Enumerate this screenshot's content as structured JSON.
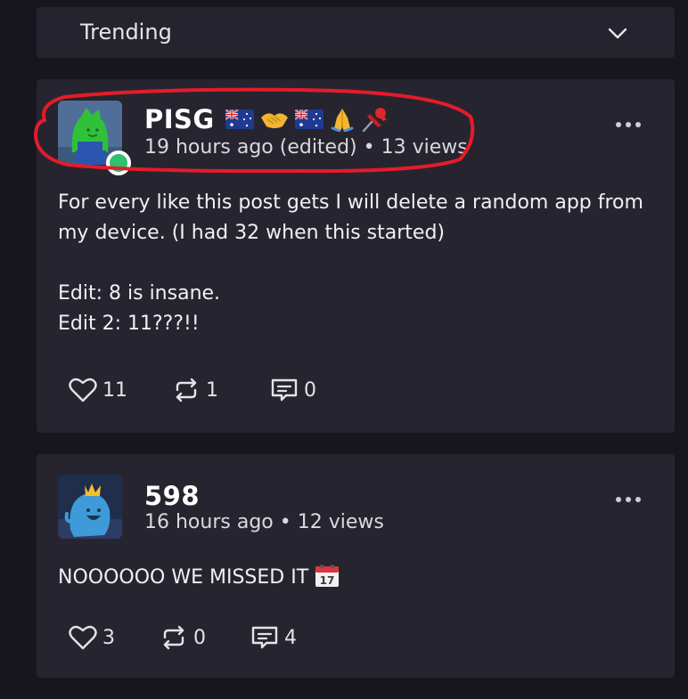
{
  "filter": {
    "selected": "Trending"
  },
  "posts": [
    {
      "username": "PISG",
      "badges": [
        "australia-flag",
        "handshake",
        "australia-flag",
        "folded-hands",
        "pushpin"
      ],
      "meta": "19 hours ago (edited) • 13 views",
      "body": "For every like this post gets I will delete a random app from my device. (I had 32 when this started)\n\nEdit: 8 is insane.\nEdit 2: 11???!!",
      "likes": "11",
      "reposts": "1",
      "comments": "0",
      "online": true
    },
    {
      "username": "598",
      "meta": "16 hours ago • 12 views",
      "body": "NOOOOOO WE MISSED IT",
      "body_emoji": "calendar-17",
      "likes": "3",
      "reposts": "0",
      "comments": "4"
    }
  ],
  "colors": {
    "background": "#17161f",
    "card": "#26252f",
    "online": "#2fbf71",
    "annotation": "#e51b2a"
  }
}
